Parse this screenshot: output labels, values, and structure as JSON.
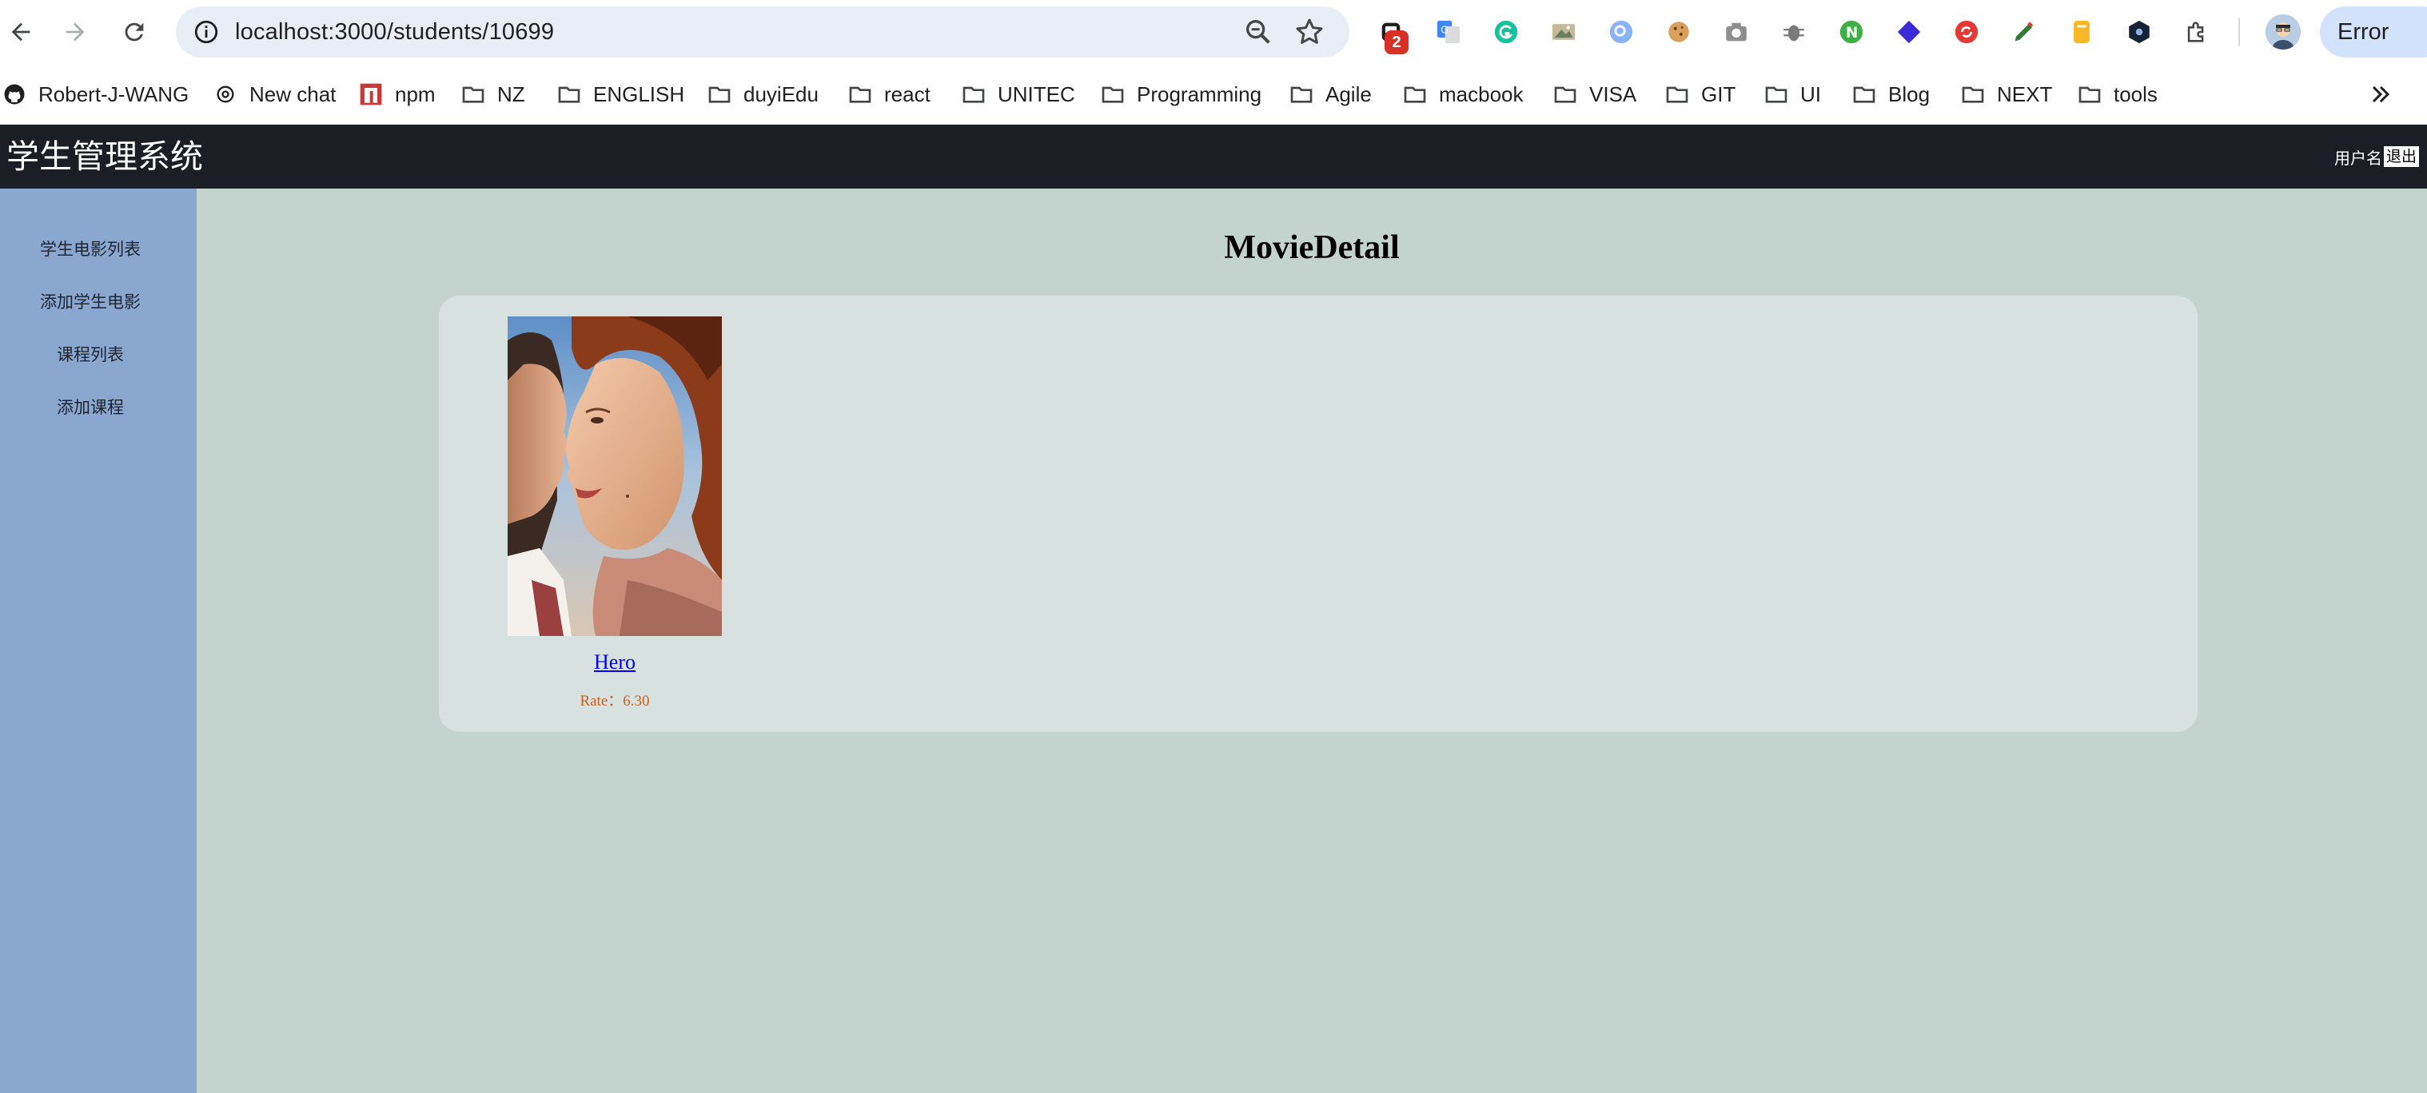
{
  "browser": {
    "url": "localhost:3000/students/10699",
    "extension_badge": "2",
    "error_label": "Error",
    "bookmarks": [
      {
        "label": "Robert-J-WANG",
        "icon": "github-icon"
      },
      {
        "label": "New chat",
        "icon": "openai-icon"
      },
      {
        "label": "npm",
        "icon": "npm-icon"
      },
      {
        "label": "NZ",
        "icon": "folder-icon"
      },
      {
        "label": "ENGLISH",
        "icon": "folder-icon"
      },
      {
        "label": "duyiEdu",
        "icon": "folder-icon"
      },
      {
        "label": "react",
        "icon": "folder-icon"
      },
      {
        "label": "UNITEC",
        "icon": "folder-icon"
      },
      {
        "label": "Programming",
        "icon": "folder-icon"
      },
      {
        "label": "Agile",
        "icon": "folder-icon"
      },
      {
        "label": "macbook",
        "icon": "folder-icon"
      },
      {
        "label": "VISA",
        "icon": "folder-icon"
      },
      {
        "label": "GIT",
        "icon": "folder-icon"
      },
      {
        "label": "UI",
        "icon": "folder-icon"
      },
      {
        "label": "Blog",
        "icon": "folder-icon"
      },
      {
        "label": "NEXT",
        "icon": "folder-icon"
      },
      {
        "label": "tools",
        "icon": "folder-icon"
      }
    ]
  },
  "app": {
    "title": "学生管理系统",
    "user_label": "用户名",
    "logout_label": "退出",
    "colors": {
      "header_bg": "#1b1e24",
      "sidebar_bg": "#8aa7cf",
      "content_bg": "#c3d4cf",
      "panel_bg": "#d7e1df",
      "link": "#0000ee",
      "rate": "#c8601e"
    }
  },
  "sidebar": {
    "items": [
      {
        "label": "学生电影列表"
      },
      {
        "label": "添加学生电影"
      },
      {
        "label": "课程列表"
      },
      {
        "label": "添加课程"
      }
    ]
  },
  "main": {
    "heading": "MovieDetail",
    "movie": {
      "name": "Hero",
      "rate_label": "Rate：",
      "rate_value": "6.30"
    }
  }
}
